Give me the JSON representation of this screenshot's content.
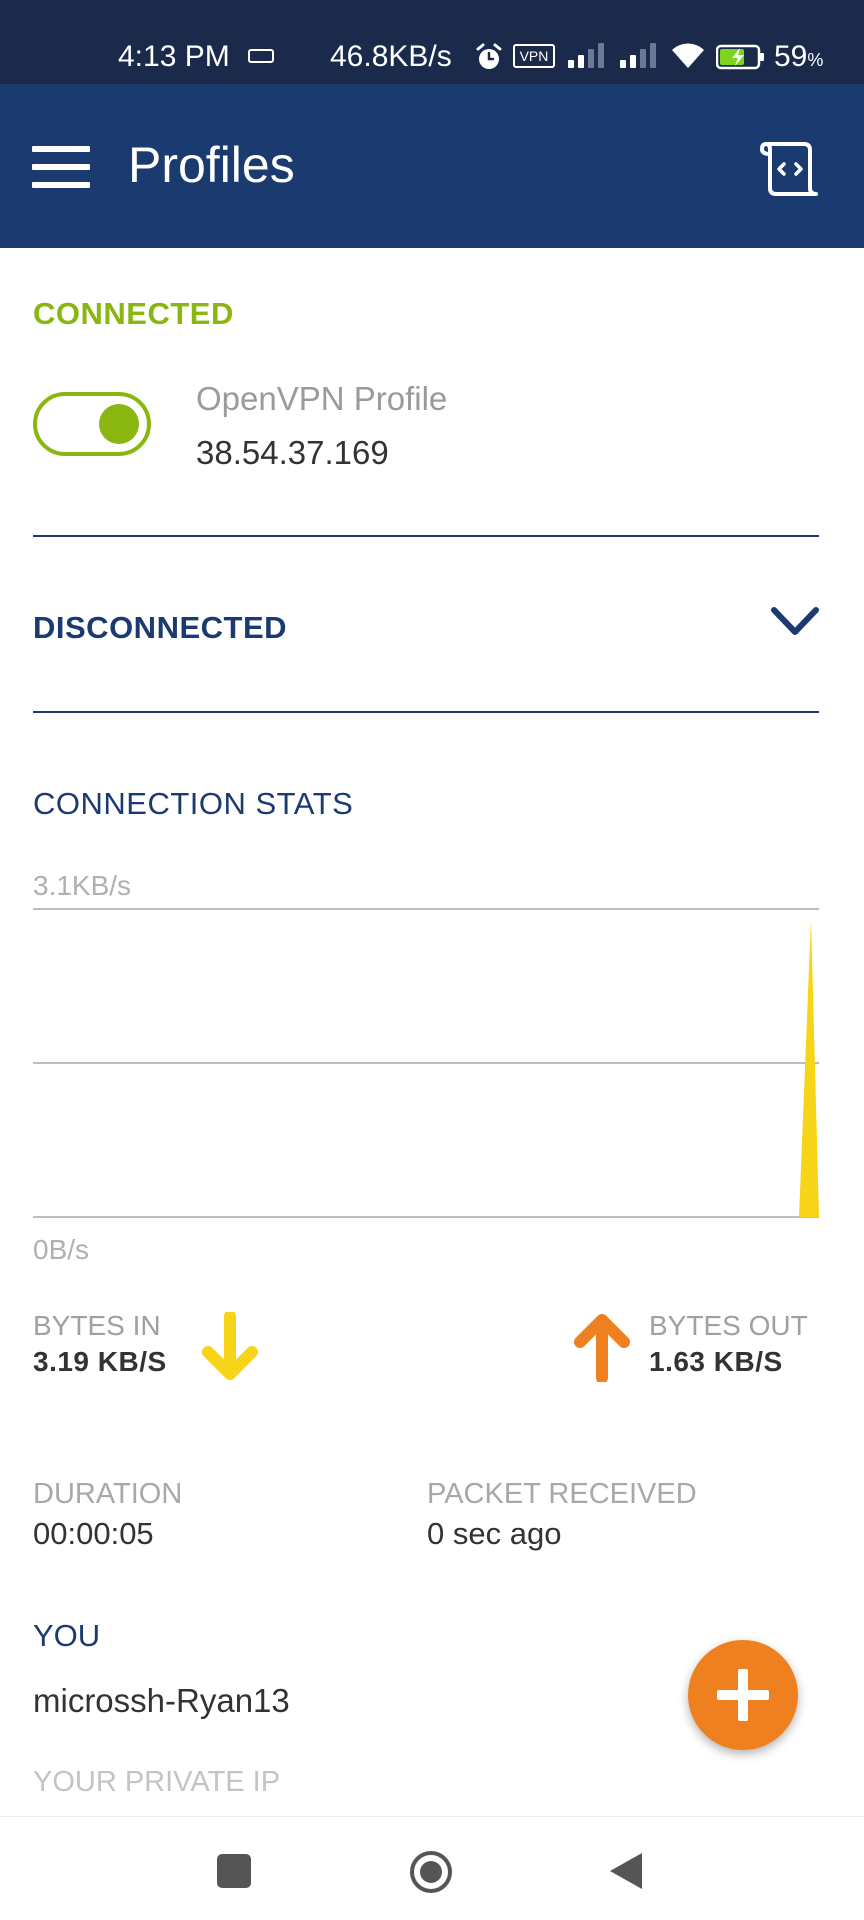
{
  "status_bar": {
    "time": "4:13 PM",
    "net_speed": "46.8KB/s",
    "vpn_badge": "VPN",
    "battery_percent": "59",
    "battery_unit": "%",
    "icons": [
      "sim-icon",
      "alarm-icon",
      "vpn-icon",
      "signal-icon",
      "wifi-icon",
      "battery-charging-icon"
    ]
  },
  "app_bar": {
    "title": "Profiles",
    "icons": [
      "menu-icon",
      "log-icon"
    ]
  },
  "connected": {
    "header": "CONNECTED",
    "profile_name": "OpenVPN Profile",
    "profile_ip": "38.54.37.169",
    "toggle_on": true
  },
  "disconnected": {
    "header": "DISCONNECTED",
    "icon": "chevron-down-icon"
  },
  "connection_stats": {
    "header": "CONNECTION STATS",
    "axis_max": "3.1KB/s",
    "axis_min": "0B/s",
    "bytes_in_label": "BYTES IN",
    "bytes_in_value": "3.19 KB/S",
    "bytes_out_label": "BYTES OUT",
    "bytes_out_value": "1.63 KB/S",
    "duration_label": "DURATION",
    "duration_value": "00:00:05",
    "packet_label": "PACKET RECEIVED",
    "packet_value": "0 sec ago",
    "colors": {
      "bytes_in": "#f7d417",
      "bytes_out": "#ef8020"
    }
  },
  "you": {
    "label": "YOU",
    "name": "microssh-Ryan13",
    "private_ip_label": "YOUR PRIVATE IP"
  },
  "colors": {
    "status_bar": "#1b2a4a",
    "app_bar": "#1b3b70",
    "connected_green": "#8ab611",
    "fab_orange": "#ef8020"
  },
  "nav_bar": {
    "icons": [
      "recents-icon",
      "home-icon",
      "back-icon"
    ]
  }
}
